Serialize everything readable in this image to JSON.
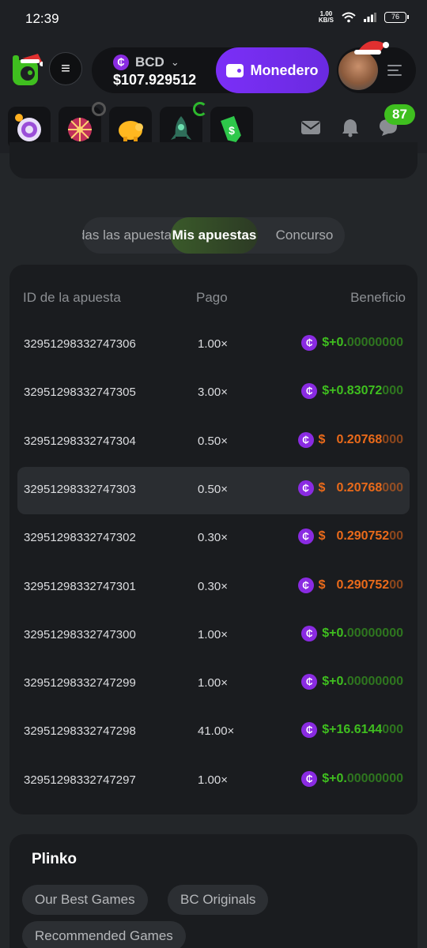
{
  "status_bar": {
    "time": "12:39",
    "speed_top": "1.00",
    "speed_unit": "KB/S",
    "battery": "76"
  },
  "header": {
    "currency": "BCD",
    "balance": "$107.929512",
    "wallet_label": "Monedero"
  },
  "notifications": {
    "chat_badge": "87"
  },
  "tabs": [
    {
      "label": "Todas las apuestas",
      "active": false
    },
    {
      "label": "Mis apuestas",
      "active": true
    },
    {
      "label": "Concurso",
      "active": false
    }
  ],
  "table": {
    "headers": [
      "ID de la apuesta",
      "Pago",
      "Beneficio"
    ],
    "rows": [
      {
        "id": "32951298332747306",
        "payout": "1.00×",
        "profit_prefix": "$+0",
        "profit_main": ".",
        "profit_rest": "00000000",
        "type": "pos"
      },
      {
        "id": "32951298332747305",
        "payout": "3.00×",
        "profit_prefix": "$+0.",
        "profit_main": "83072",
        "profit_rest": "000",
        "type": "pos"
      },
      {
        "id": "32951298332747304",
        "payout": "0.50×",
        "profit_prefix": "$",
        "profit_main": "0.20768",
        "profit_rest": "000",
        "type": "neg"
      },
      {
        "id": "32951298332747303",
        "payout": "0.50×",
        "profit_prefix": "$",
        "profit_main": "0.20768",
        "profit_rest": "000",
        "type": "neg"
      },
      {
        "id": "32951298332747302",
        "payout": "0.30×",
        "profit_prefix": "$",
        "profit_main": "0.290752",
        "profit_rest": "00",
        "type": "neg"
      },
      {
        "id": "32951298332747301",
        "payout": "0.30×",
        "profit_prefix": "$",
        "profit_main": "0.290752",
        "profit_rest": "00",
        "type": "neg"
      },
      {
        "id": "32951298332747300",
        "payout": "1.00×",
        "profit_prefix": "$+0",
        "profit_main": ".",
        "profit_rest": "00000000",
        "type": "pos"
      },
      {
        "id": "32951298332747299",
        "payout": "1.00×",
        "profit_prefix": "$+0",
        "profit_main": ".",
        "profit_rest": "00000000",
        "type": "pos"
      },
      {
        "id": "32951298332747298",
        "payout": "41.00×",
        "profit_prefix": "$+16.",
        "profit_main": "6144",
        "profit_rest": "000",
        "type": "pos"
      },
      {
        "id": "32951298332747297",
        "payout": "1.00×",
        "profit_prefix": "$+0",
        "profit_main": ".",
        "profit_rest": "00000000",
        "type": "pos"
      }
    ]
  },
  "plinko": {
    "title": "Plinko",
    "chips": [
      "Our Best Games",
      "BC Originals",
      "Recommended Games"
    ]
  },
  "colors": {
    "accent_purple": "#7b2ff7",
    "positive": "#3fbf1f",
    "negative": "#ea6a1a"
  }
}
